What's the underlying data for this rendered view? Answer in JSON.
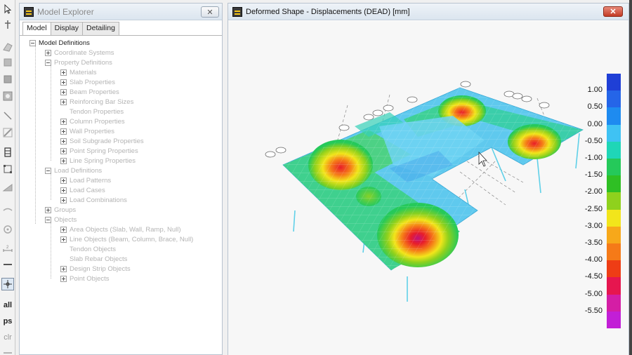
{
  "explorer": {
    "title": "Model Explorer",
    "close_glyph": "✕",
    "tabs": [
      "Model",
      "Display",
      "Detailing"
    ],
    "root": "Model Definitions",
    "items": [
      "Coordinate Systems",
      "Property Definitions",
      "Materials",
      "Slab Properties",
      "Beam Properties",
      "Reinforcing Bar Sizes",
      "Tendon Properties",
      "Column Properties",
      "Wall Properties",
      "Soil Subgrade Properties",
      "Point Spring Properties",
      "Line Spring Properties",
      "Load Definitions",
      "Load Patterns",
      "Load Cases",
      "Load Combinations",
      "Groups",
      "Objects",
      "Area Objects (Slab, Wall, Ramp, Null)",
      "Line Objects (Beam, Column, Brace, Null)",
      "Tendon Objects",
      "Slab Rebar Objects",
      "Design Strip Objects",
      "Point Objects"
    ]
  },
  "deformed": {
    "title": "Deformed Shape - Displacements (DEAD)  [mm]",
    "close_glyph": "✕"
  },
  "legend": {
    "labels": [
      "1.00",
      "0.50",
      "0.00",
      "-0.50",
      "-1.00",
      "-1.50",
      "-2.00",
      "-2.50",
      "-3.00",
      "-3.50",
      "-4.00",
      "-4.50",
      "-5.00",
      "-5.50"
    ],
    "colors": [
      "#1f3fd6",
      "#2565e8",
      "#1e8bf0",
      "#3fc2f3",
      "#1fd6b7",
      "#25c95a",
      "#2fbf24",
      "#8fd11d",
      "#f2e51b",
      "#f7a81a",
      "#f57a18",
      "#ee3d15",
      "#e6164f",
      "#d41ea5",
      "#c21fd6"
    ]
  },
  "toolbar": {
    "text_buttons": [
      "all",
      "ps",
      "clr"
    ]
  }
}
